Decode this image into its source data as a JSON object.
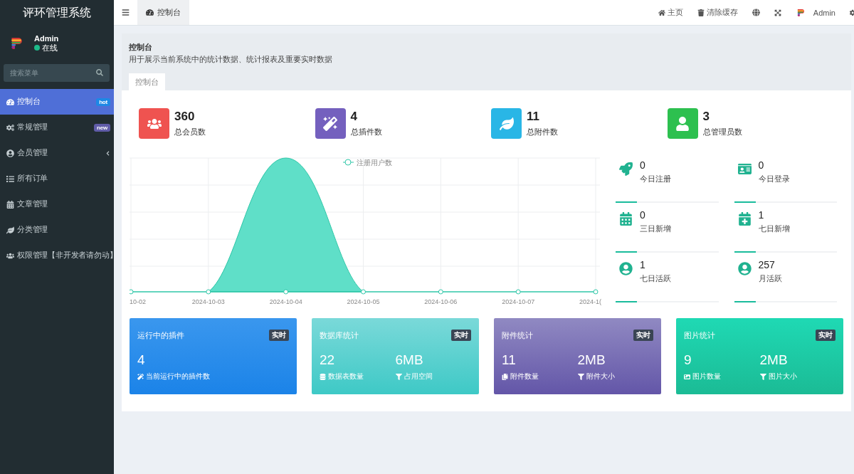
{
  "sidebar": {
    "app_title": "评环管理系统",
    "user": {
      "name": "Admin",
      "status": "在线",
      "online": true
    },
    "search": {
      "placeholder": "搜索菜单"
    },
    "items": [
      {
        "label": "控制台",
        "kind": "link",
        "selected": true,
        "badge": {
          "text": "hot",
          "color": "#1e88e5"
        }
      },
      {
        "label": "常规管理",
        "kind": "link",
        "selected": false,
        "badge": {
          "text": "new",
          "color": "#605ca8"
        }
      },
      {
        "label": "会员管理",
        "kind": "group",
        "selected": false,
        "expanded": false
      },
      {
        "label": "所有订单",
        "kind": "link",
        "selected": false
      },
      {
        "label": "文章管理",
        "kind": "link",
        "selected": false
      },
      {
        "label": "分类管理",
        "kind": "link",
        "selected": false
      },
      {
        "label": "权限管理【非开发者请勿动】",
        "kind": "link",
        "selected": false
      }
    ]
  },
  "topbar": {
    "tabs": [
      {
        "label": "控制台",
        "selected": true
      }
    ],
    "links": [
      "主页",
      "清除缓存"
    ],
    "user": "Admin"
  },
  "panel": {
    "title": "控制台",
    "description": "用于展示当前系统中的统计数据、统计报表及重要实时数据",
    "tabs": [
      {
        "label": "控制台",
        "selected": true
      }
    ]
  },
  "stats": [
    {
      "value": "360",
      "label": "总会员数"
    },
    {
      "value": "4",
      "label": "总插件数"
    },
    {
      "value": "11",
      "label": "总附件数"
    },
    {
      "value": "3",
      "label": "总管理员数"
    }
  ],
  "chart": {
    "legend": "注册用户数",
    "x_labels": [
      "10-02",
      "2024-10-03",
      "2024-10-04",
      "2024-10-05",
      "2024-10-06",
      "2024-10-07",
      "2024-1("
    ]
  },
  "mini_stats": [
    {
      "value": "0",
      "label": "今日注册"
    },
    {
      "value": "0",
      "label": "今日登录"
    },
    {
      "value": "0",
      "label": "三日新增"
    },
    {
      "value": "1",
      "label": "七日新增"
    },
    {
      "value": "1",
      "label": "七日活跃"
    },
    {
      "value": "257",
      "label": "月活跃"
    }
  ],
  "cards": [
    {
      "title": "运行中的插件",
      "badge": "实时",
      "metrics": [
        {
          "value": "4",
          "label": "当前运行中的插件数"
        }
      ]
    },
    {
      "title": "数据库统计",
      "badge": "实时",
      "metrics": [
        {
          "value": "22",
          "label": "数据表数量"
        },
        {
          "value": "6MB",
          "label": "占用空间"
        }
      ]
    },
    {
      "title": "附件统计",
      "badge": "实时",
      "metrics": [
        {
          "value": "11",
          "label": "附件数量"
        },
        {
          "value": "2MB",
          "label": "附件大小"
        }
      ]
    },
    {
      "title": "图片统计",
      "badge": "实时",
      "metrics": [
        {
          "value": "9",
          "label": "图片数量"
        },
        {
          "value": "2MB",
          "label": "图片大小"
        }
      ]
    }
  ]
}
